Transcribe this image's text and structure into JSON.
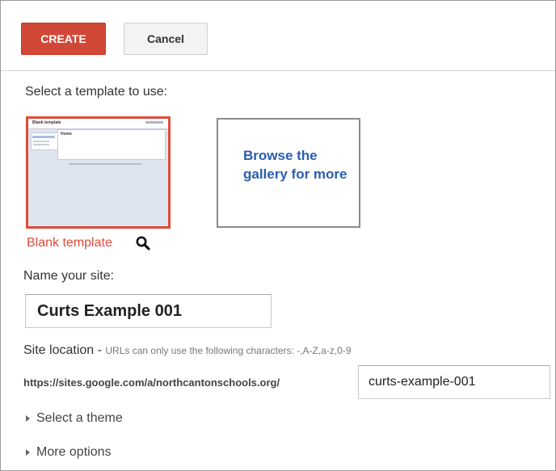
{
  "toolbar": {
    "create_label": "CREATE",
    "cancel_label": "Cancel"
  },
  "template_section": {
    "label": "Select a template to use:",
    "selected_template": {
      "caption": "Blank template",
      "thumbnail_title": "Blank template",
      "thumbnail_page_title": "Home",
      "preview_icon": "magnifier-icon"
    },
    "gallery_link": "Browse the gallery for more"
  },
  "site_name": {
    "label": "Name your site:",
    "value": "Curts Example 001"
  },
  "site_location": {
    "label": "Site location - ",
    "hint": "URLs can only use the following characters: -,A-Z,a-z,0-9",
    "url_prefix": "https://sites.google.com/a/northcantonschools.org/",
    "value": "curts-example-001"
  },
  "expanders": {
    "theme": "Select a theme",
    "more_options": "More options"
  },
  "colors": {
    "create_button": "#d14836",
    "selected_border": "#dd4b39",
    "link_blue": "#2a5db0"
  }
}
